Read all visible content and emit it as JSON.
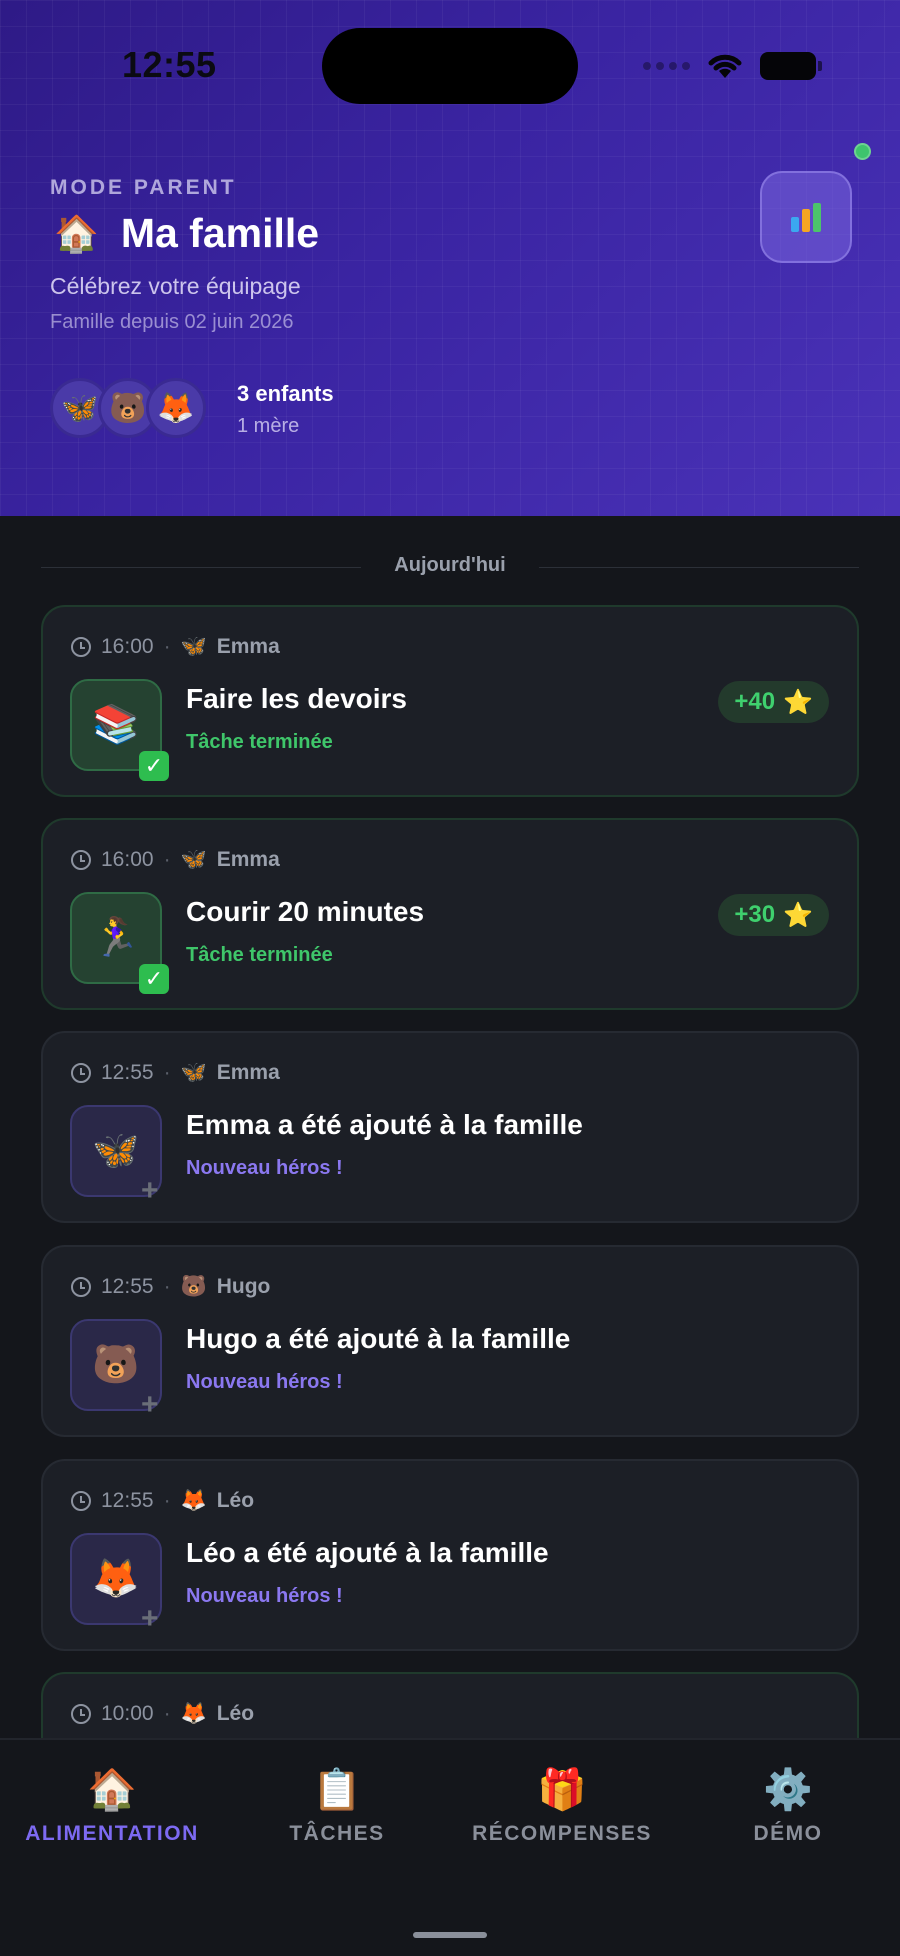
{
  "status_bar": {
    "time": "12:55"
  },
  "header": {
    "mode_label": "MODE PARENT",
    "title_emoji": "🏠",
    "title": "Ma famille",
    "tagline": "Célébrez votre équipage",
    "since": "Famille depuis 02 juin 2026",
    "stats_icon": "bar-chart-icon",
    "avatars": [
      "🦋",
      "🐻",
      "🦊"
    ],
    "kids_count": "3 enfants",
    "parents_count": "1 mère"
  },
  "feed": {
    "day_label": "Aujourd'hui",
    "items": [
      {
        "time": "16:00",
        "kid_emoji": "🦋",
        "kid": "Emma",
        "icon": "📚",
        "title": "Faire les devoirs",
        "subtitle": "Tâche terminée",
        "points": "+40",
        "star": "⭐"
      },
      {
        "time": "16:00",
        "kid_emoji": "🦋",
        "kid": "Emma",
        "icon": "🏃‍♀️",
        "title": "Courir 20 minutes",
        "subtitle": "Tâche terminée",
        "points": "+30",
        "star": "⭐"
      },
      {
        "time": "12:55",
        "kid_emoji": "🦋",
        "kid": "Emma",
        "icon": "🦋",
        "title": "Emma a été ajouté à la famille",
        "subtitle": "Nouveau héros !"
      },
      {
        "time": "12:55",
        "kid_emoji": "🐻",
        "kid": "Hugo",
        "icon": "🐻",
        "title": "Hugo a été ajouté à la famille",
        "subtitle": "Nouveau héros !"
      },
      {
        "time": "12:55",
        "kid_emoji": "🦊",
        "kid": "Léo",
        "icon": "🦊",
        "title": "Léo a été ajouté à la famille",
        "subtitle": "Nouveau héros !"
      },
      {
        "time": "10:00",
        "kid_emoji": "🦊",
        "kid": "Léo"
      }
    ],
    "check_mark": "✓",
    "plus_mark": "+"
  },
  "tabs": [
    {
      "icon": "🏠",
      "label": "ALIMENTATION",
      "active": true
    },
    {
      "icon": "📋",
      "label": "TÂCHES",
      "active": false
    },
    {
      "icon": "🎁",
      "label": "RÉCOMPENSES",
      "active": false
    },
    {
      "icon": "⚙️",
      "label": "DÉMO",
      "active": false
    }
  ],
  "colors": {
    "accent": "#7d6af2",
    "success": "#3fc66a",
    "header_start": "#2e1a86",
    "header_end": "#4a32b8"
  }
}
